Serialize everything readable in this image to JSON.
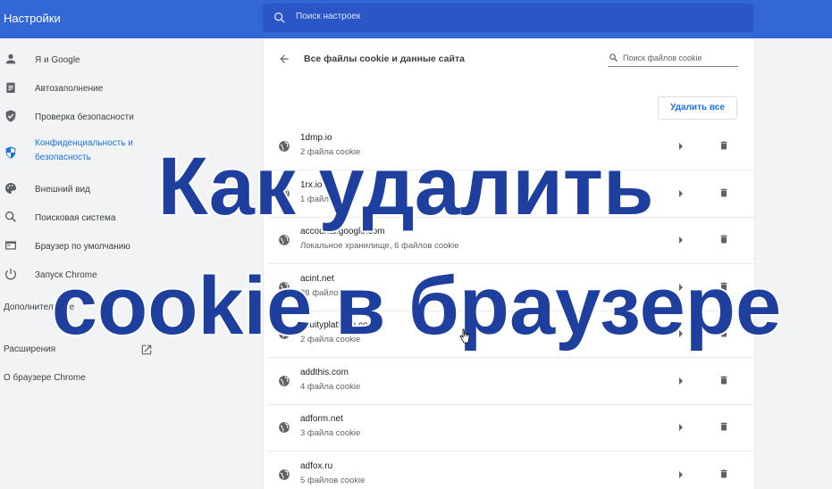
{
  "header": {
    "title": "Настройки",
    "search_placeholder": "Поиск настроек"
  },
  "sidebar": {
    "items": [
      {
        "label": "Я и Google",
        "icon": "person-icon"
      },
      {
        "label": "Автозаполнение",
        "icon": "clipboard-icon"
      },
      {
        "label": "Проверка безопасности",
        "icon": "shield-icon"
      },
      {
        "label": "Конфиденциальность и безопасность",
        "icon": "privacy-shield-icon",
        "active": true
      },
      {
        "label": "Внешний вид",
        "icon": "palette-icon"
      },
      {
        "label": "Поисковая система",
        "icon": "search-icon"
      },
      {
        "label": "Браузер по умолчанию",
        "icon": "browser-icon"
      },
      {
        "label": "Запуск Chrome",
        "icon": "power-icon"
      }
    ],
    "advanced_label": "Дополнительные",
    "extensions_label": "Расширения",
    "about_label": "О браузере Chrome"
  },
  "cookies_page": {
    "title": "Все файлы cookie и данные сайта",
    "search_placeholder": "Поиск файлов cookie",
    "delete_all_label": "Удалить все",
    "sites": [
      {
        "domain": "1dmp.io",
        "info": "2 файла cookie"
      },
      {
        "domain": "1rx.io",
        "info": "1 файл cookie"
      },
      {
        "domain": "accounts.google.com",
        "info": "Локальное хранилище, 6 файлов cookie"
      },
      {
        "domain": "acint.net",
        "info": "28 файлов cookie"
      },
      {
        "domain": "acuityplatform.com",
        "info": "2 файла cookie"
      },
      {
        "domain": "addthis.com",
        "info": "4 файла cookie"
      },
      {
        "domain": "adform.net",
        "info": "3 файла cookie"
      },
      {
        "domain": "adfox.ru",
        "info": "5 файлов cookie"
      }
    ]
  },
  "overlay": {
    "line1": "Как удалить",
    "line2": "cookie в браузере"
  },
  "colors": {
    "header_blue": "#3367d6",
    "accent_blue": "#1a73e8",
    "overlay_text": "#1f3f9e"
  }
}
